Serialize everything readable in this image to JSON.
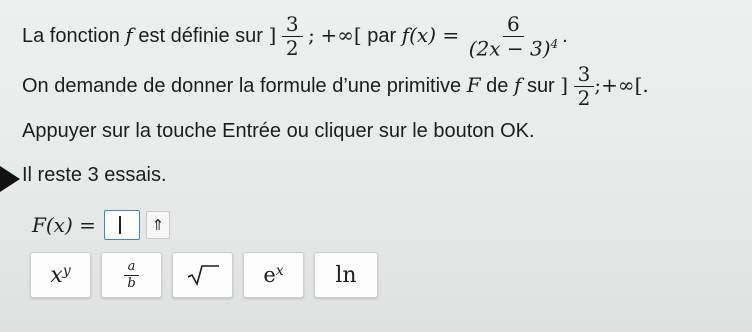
{
  "question": {
    "line1": {
      "prefix": "La fonction",
      "f": "f",
      "mid": "est définie sur",
      "interval_open": "]",
      "int_num": "3",
      "int_den": "2",
      "int_sep": ";",
      "infinity": "+∞",
      "interval_close": "[",
      "par": "par",
      "fx": "f(x) =",
      "num": "6",
      "den_base": "(2x − 3)",
      "den_exp": "4",
      "end": "."
    },
    "line2": {
      "text": "On demande de donner la formule d’une primitive",
      "F": "F",
      "de": "de",
      "f": "f",
      "sur": "sur",
      "interval_open": "]",
      "int_num": "3",
      "int_den": "2",
      "int_sep": ";",
      "infinity": "+∞",
      "interval_close": "[."
    },
    "instruction": "Appuyer sur la touche Entrée ou cliquer sur le bouton OK.",
    "attempts": "Il reste 3 essais."
  },
  "answer": {
    "label": "F(x) =",
    "value": ""
  },
  "icons": {
    "expand": "double-up-arrow-icon",
    "expand_glyph": "⇑"
  },
  "toolbar": {
    "power_base": "x",
    "power_exp": "y",
    "frac_num": "a",
    "frac_den": "b",
    "exp_base": "e",
    "exp_exp": "x",
    "ln_label": "ln"
  },
  "colors": {
    "input_border": "#3a86c8",
    "text": "#1d1d1f"
  }
}
